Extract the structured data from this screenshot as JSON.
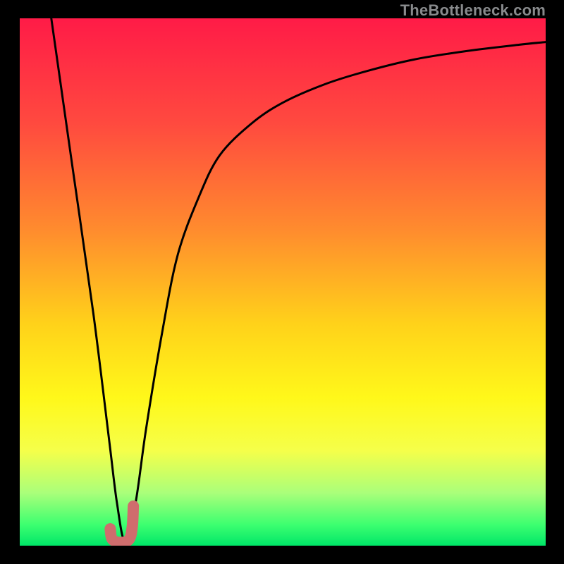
{
  "watermark": {
    "text": "TheBottleneck.com"
  },
  "gradient": {
    "stops": [
      {
        "offset": 0.0,
        "color": "#ff1b47"
      },
      {
        "offset": 0.2,
        "color": "#ff4a3f"
      },
      {
        "offset": 0.4,
        "color": "#ff8b2e"
      },
      {
        "offset": 0.58,
        "color": "#ffd21a"
      },
      {
        "offset": 0.72,
        "color": "#fff81a"
      },
      {
        "offset": 0.82,
        "color": "#f5ff4a"
      },
      {
        "offset": 0.9,
        "color": "#aaff7a"
      },
      {
        "offset": 0.96,
        "color": "#3dff70"
      },
      {
        "offset": 1.0,
        "color": "#00e668"
      }
    ]
  },
  "chart_data": {
    "type": "line",
    "title": "",
    "xlabel": "",
    "ylabel": "",
    "xlim": [
      0,
      100
    ],
    "ylim": [
      0,
      100
    ],
    "series": [
      {
        "name": "bottleneck-curve",
        "x": [
          6,
          10,
          14,
          17,
          18.5,
          20,
          22,
          24,
          27,
          30,
          34,
          38,
          44,
          50,
          58,
          66,
          75,
          85,
          95,
          100
        ],
        "values": [
          100,
          72,
          44,
          20,
          8,
          1,
          8,
          22,
          40,
          55,
          66,
          74,
          80,
          84,
          87.5,
          90,
          92.2,
          93.8,
          95.0,
          95.5
        ]
      }
    ],
    "marker": {
      "name": "j-marker",
      "color": "#cf6d6d",
      "stroke_width": 16,
      "points": [
        {
          "x": 17.2,
          "y": 3.2
        },
        {
          "x": 17.6,
          "y": 1.2
        },
        {
          "x": 19.2,
          "y": 0.6
        },
        {
          "x": 20.8,
          "y": 1.2
        },
        {
          "x": 21.4,
          "y": 3.6
        },
        {
          "x": 21.6,
          "y": 7.5
        }
      ]
    }
  }
}
